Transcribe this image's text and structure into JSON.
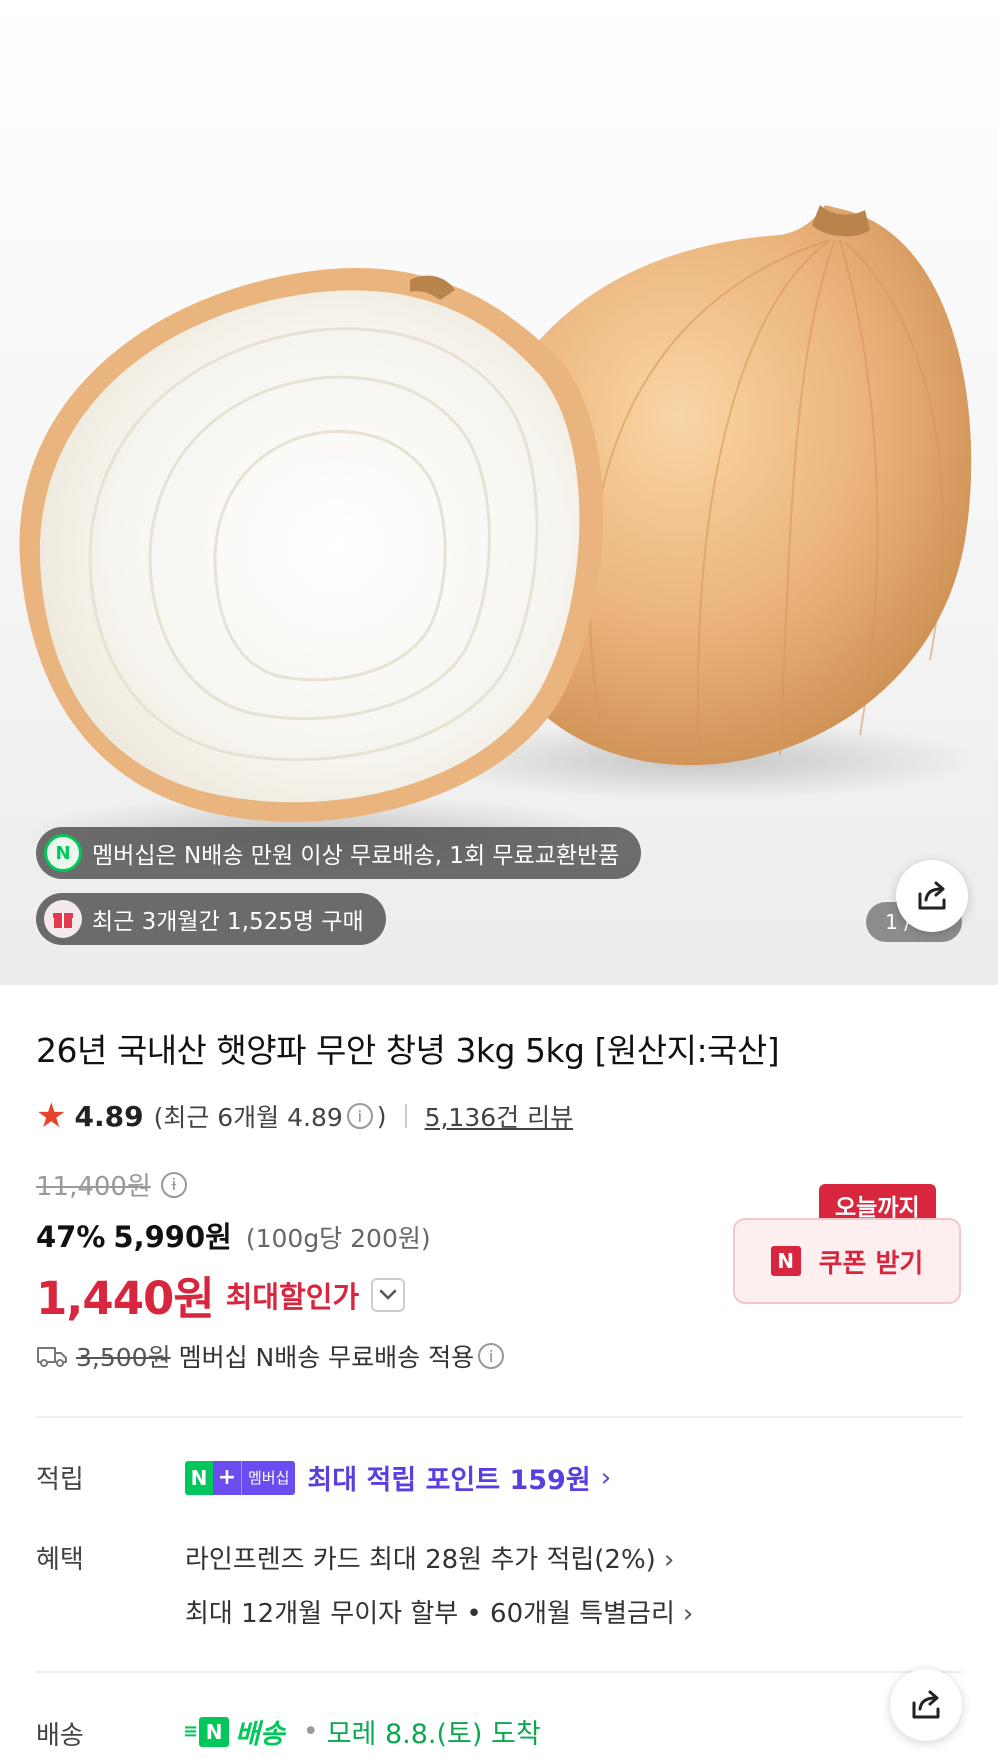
{
  "hero": {
    "banner_membership": "멤버십은 N배송 만원 이상 무료배송, 1회 무료교환반품",
    "banner_membership_icon": "n-delivery-icon",
    "banner_recent": "최근 3개월간 1,525명 구매",
    "banner_recent_icon": "gift-box-icon",
    "pager": "1 / 10"
  },
  "product": {
    "title": "26년 국내산 햇양파 무안 창녕 3kg 5kg [원산지:국산]",
    "rating": "4.89",
    "rating_recent": "(최근 6개월 4.89",
    "rating_recent_close": ")",
    "reviews": "5,136건 리뷰",
    "original_price": "11,400원",
    "discount_rate": "47%",
    "sale_price": "5,990원",
    "unit_price": "(100g당 200원)",
    "final_price": "1,440원",
    "final_label": "최대할인가",
    "coupon_tag": "오늘까지",
    "coupon_button": "쿠폰 받기",
    "shipping_original": "3,500원",
    "shipping_text": "멤버십 N배송 무료배송 적용"
  },
  "details": {
    "points_label": "적립",
    "points_badge_n": "N",
    "points_badge_plus": "+",
    "points_badge_member": "멤버십",
    "points_text": "최대 적립 포인트 159원",
    "benefit_label": "혜택",
    "benefit_1": "라인프렌즈 카드 최대 28원 추가 적립(2%)",
    "benefit_2": "최대 12개월 무이자 할부 • 60개월 특별금리",
    "shipping_label": "배송",
    "shipping_brand": "배송",
    "shipping_arrival": "모레 8.8.(토) 도착"
  },
  "colors": {
    "accent_red": "#d7263d",
    "naver_green": "#03c75a",
    "membership_purple": "#5b3ee0",
    "star": "#e8412c"
  }
}
